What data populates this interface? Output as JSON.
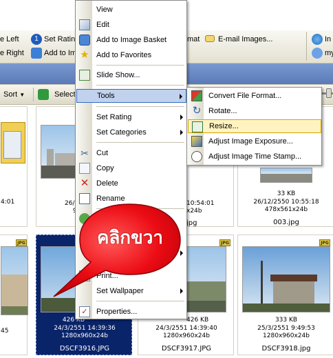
{
  "toolbar": {
    "row1": [
      "e Left",
      "Set Rating",
      "mat",
      "E-mail Images...",
      "In"
    ],
    "row2": [
      "e Right",
      "Add to Im",
      "my"
    ],
    "sort_label": "Sort",
    "select_label": "Select"
  },
  "tiles": [
    {
      "info1": "",
      "info2": "",
      "info3": "4:01",
      "name": ""
    },
    {
      "info1": "",
      "info2": "26/12/",
      "info3": "901",
      "name": "00"
    },
    {
      "info1": "",
      "info2": "",
      "info3": "",
      "name": ""
    },
    {
      "info1": "",
      "info2": "10:54:01",
      "info3": "x24b",
      "name": "jpg"
    },
    {
      "info1": "33 KB",
      "info2": "26/12/2550 10:55:18",
      "info3": "478x561x24b",
      "name": "003.jpg"
    },
    {
      "info1": "",
      "info2": "",
      "info3": "45",
      "name": "JPG"
    },
    {
      "info1": "426 KB",
      "info2": "24/3/2551 14:39:36",
      "info3": "1280x960x24b",
      "name": "DSCF3916.JPG"
    },
    {
      "info1": "426 KB",
      "info2": "24/3/2551 14:39:40",
      "info3": "1280x960x24b",
      "name": "DSCF3917.JPG"
    },
    {
      "info1": "333 KB",
      "info2": "25/3/2551 9:49:53",
      "info3": "1280x960x24b",
      "name": "DSCF3918.jpg"
    }
  ],
  "badge_text": "JPG",
  "context_menu": {
    "view": "View",
    "edit": "Edit",
    "add_basket": "Add to Image Basket",
    "add_favorites": "Add to Favorites",
    "slide_show": "Slide Show...",
    "tools": "Tools",
    "set_rating": "Set Rating",
    "set_categories": "Set Categories",
    "cut": "Cut",
    "copy": "Copy",
    "delete": "Delete",
    "rename": "Rename",
    "print": "Print...",
    "set_wallpaper": "Set Wallpaper",
    "properties": "Properties..."
  },
  "tools_submenu": {
    "convert": "Convert File Format...",
    "rotate": "Rotate...",
    "resize": "Resize...",
    "exposure": "Adjust Image Exposure...",
    "timestamp": "Adjust Image Time Stamp..."
  },
  "callout_text": "คลิกขวา",
  "colors": {
    "menu_highlight": "#c1d2ee",
    "submenu_highlight": "#fff3c2",
    "selection_blue": "#0a246a",
    "callout_red": "#e8000f"
  }
}
